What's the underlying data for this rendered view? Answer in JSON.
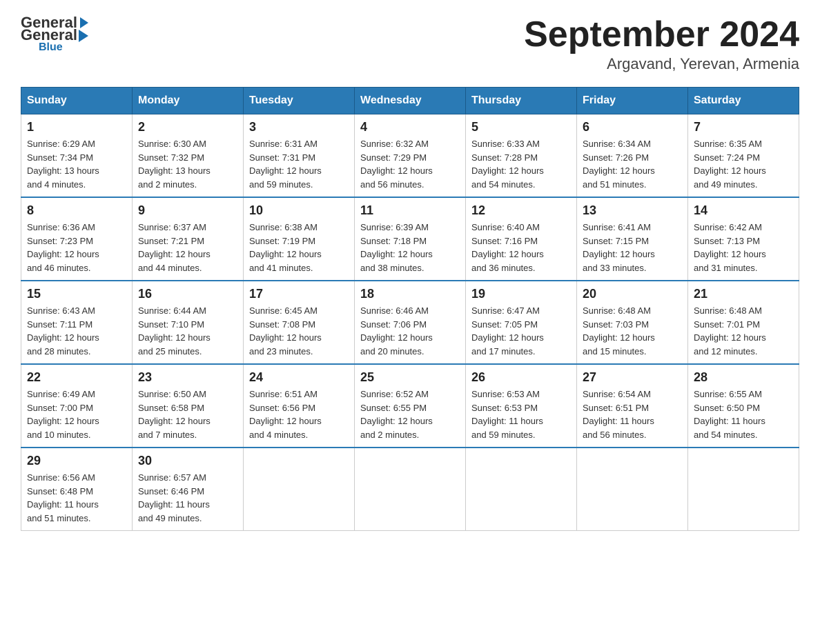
{
  "header": {
    "logo_general": "General",
    "logo_blue": "Blue",
    "month_title": "September 2024",
    "location": "Argavand, Yerevan, Armenia"
  },
  "columns": [
    "Sunday",
    "Monday",
    "Tuesday",
    "Wednesday",
    "Thursday",
    "Friday",
    "Saturday"
  ],
  "weeks": [
    [
      {
        "day": "1",
        "sunrise": "6:29 AM",
        "sunset": "7:34 PM",
        "daylight": "13 hours and 4 minutes."
      },
      {
        "day": "2",
        "sunrise": "6:30 AM",
        "sunset": "7:32 PM",
        "daylight": "13 hours and 2 minutes."
      },
      {
        "day": "3",
        "sunrise": "6:31 AM",
        "sunset": "7:31 PM",
        "daylight": "12 hours and 59 minutes."
      },
      {
        "day": "4",
        "sunrise": "6:32 AM",
        "sunset": "7:29 PM",
        "daylight": "12 hours and 56 minutes."
      },
      {
        "day": "5",
        "sunrise": "6:33 AM",
        "sunset": "7:28 PM",
        "daylight": "12 hours and 54 minutes."
      },
      {
        "day": "6",
        "sunrise": "6:34 AM",
        "sunset": "7:26 PM",
        "daylight": "12 hours and 51 minutes."
      },
      {
        "day": "7",
        "sunrise": "6:35 AM",
        "sunset": "7:24 PM",
        "daylight": "12 hours and 49 minutes."
      }
    ],
    [
      {
        "day": "8",
        "sunrise": "6:36 AM",
        "sunset": "7:23 PM",
        "daylight": "12 hours and 46 minutes."
      },
      {
        "day": "9",
        "sunrise": "6:37 AM",
        "sunset": "7:21 PM",
        "daylight": "12 hours and 44 minutes."
      },
      {
        "day": "10",
        "sunrise": "6:38 AM",
        "sunset": "7:19 PM",
        "daylight": "12 hours and 41 minutes."
      },
      {
        "day": "11",
        "sunrise": "6:39 AM",
        "sunset": "7:18 PM",
        "daylight": "12 hours and 38 minutes."
      },
      {
        "day": "12",
        "sunrise": "6:40 AM",
        "sunset": "7:16 PM",
        "daylight": "12 hours and 36 minutes."
      },
      {
        "day": "13",
        "sunrise": "6:41 AM",
        "sunset": "7:15 PM",
        "daylight": "12 hours and 33 minutes."
      },
      {
        "day": "14",
        "sunrise": "6:42 AM",
        "sunset": "7:13 PM",
        "daylight": "12 hours and 31 minutes."
      }
    ],
    [
      {
        "day": "15",
        "sunrise": "6:43 AM",
        "sunset": "7:11 PM",
        "daylight": "12 hours and 28 minutes."
      },
      {
        "day": "16",
        "sunrise": "6:44 AM",
        "sunset": "7:10 PM",
        "daylight": "12 hours and 25 minutes."
      },
      {
        "day": "17",
        "sunrise": "6:45 AM",
        "sunset": "7:08 PM",
        "daylight": "12 hours and 23 minutes."
      },
      {
        "day": "18",
        "sunrise": "6:46 AM",
        "sunset": "7:06 PM",
        "daylight": "12 hours and 20 minutes."
      },
      {
        "day": "19",
        "sunrise": "6:47 AM",
        "sunset": "7:05 PM",
        "daylight": "12 hours and 17 minutes."
      },
      {
        "day": "20",
        "sunrise": "6:48 AM",
        "sunset": "7:03 PM",
        "daylight": "12 hours and 15 minutes."
      },
      {
        "day": "21",
        "sunrise": "6:48 AM",
        "sunset": "7:01 PM",
        "daylight": "12 hours and 12 minutes."
      }
    ],
    [
      {
        "day": "22",
        "sunrise": "6:49 AM",
        "sunset": "7:00 PM",
        "daylight": "12 hours and 10 minutes."
      },
      {
        "day": "23",
        "sunrise": "6:50 AM",
        "sunset": "6:58 PM",
        "daylight": "12 hours and 7 minutes."
      },
      {
        "day": "24",
        "sunrise": "6:51 AM",
        "sunset": "6:56 PM",
        "daylight": "12 hours and 4 minutes."
      },
      {
        "day": "25",
        "sunrise": "6:52 AM",
        "sunset": "6:55 PM",
        "daylight": "12 hours and 2 minutes."
      },
      {
        "day": "26",
        "sunrise": "6:53 AM",
        "sunset": "6:53 PM",
        "daylight": "11 hours and 59 minutes."
      },
      {
        "day": "27",
        "sunrise": "6:54 AM",
        "sunset": "6:51 PM",
        "daylight": "11 hours and 56 minutes."
      },
      {
        "day": "28",
        "sunrise": "6:55 AM",
        "sunset": "6:50 PM",
        "daylight": "11 hours and 54 minutes."
      }
    ],
    [
      {
        "day": "29",
        "sunrise": "6:56 AM",
        "sunset": "6:48 PM",
        "daylight": "11 hours and 51 minutes."
      },
      {
        "day": "30",
        "sunrise": "6:57 AM",
        "sunset": "6:46 PM",
        "daylight": "11 hours and 49 minutes."
      },
      null,
      null,
      null,
      null,
      null
    ]
  ]
}
